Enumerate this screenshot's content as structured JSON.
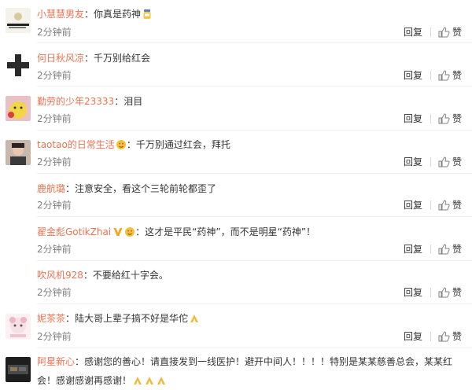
{
  "comments": [
    {
      "user": "小慧慧男友",
      "text": "你真是药神",
      "time": "2分钟前"
    },
    {
      "user": "何日秋风凉",
      "text": "千万别给红会",
      "time": "2分钟前"
    },
    {
      "user": "勤劳的少年23333",
      "text": "泪目",
      "time": "2分钟前"
    },
    {
      "user": "taotao的日常生活",
      "text": "千万别通过红会，拜托",
      "time": "2分钟前"
    },
    {
      "user": "鹿航璐",
      "text": "注意安全，看这个三轮前轮都歪了",
      "time": "2分钟前"
    },
    {
      "user": "翟金彪GotikZhai",
      "text": "这才是平民“药神”，而不是明星“药神”！",
      "time": "2分钟前"
    },
    {
      "user": "吹风机928",
      "text": "不要给红十字会。",
      "time": "2分钟前"
    },
    {
      "user": "妮茶茶",
      "text": "陆大哥上辈子搞不好是华佗",
      "time": "2分钟前"
    },
    {
      "user": "阿星新心",
      "text": "感谢您的善心！请直接发到一线医护！避开中间人！！！！特别是某某慈善总会，某某红会！感谢感谢再感谢！",
      "time": ""
    }
  ],
  "labels": {
    "colon": "：",
    "reply": "回复",
    "like": "赞"
  },
  "colors": {
    "username": "#eb7350",
    "meta": "#808080"
  }
}
